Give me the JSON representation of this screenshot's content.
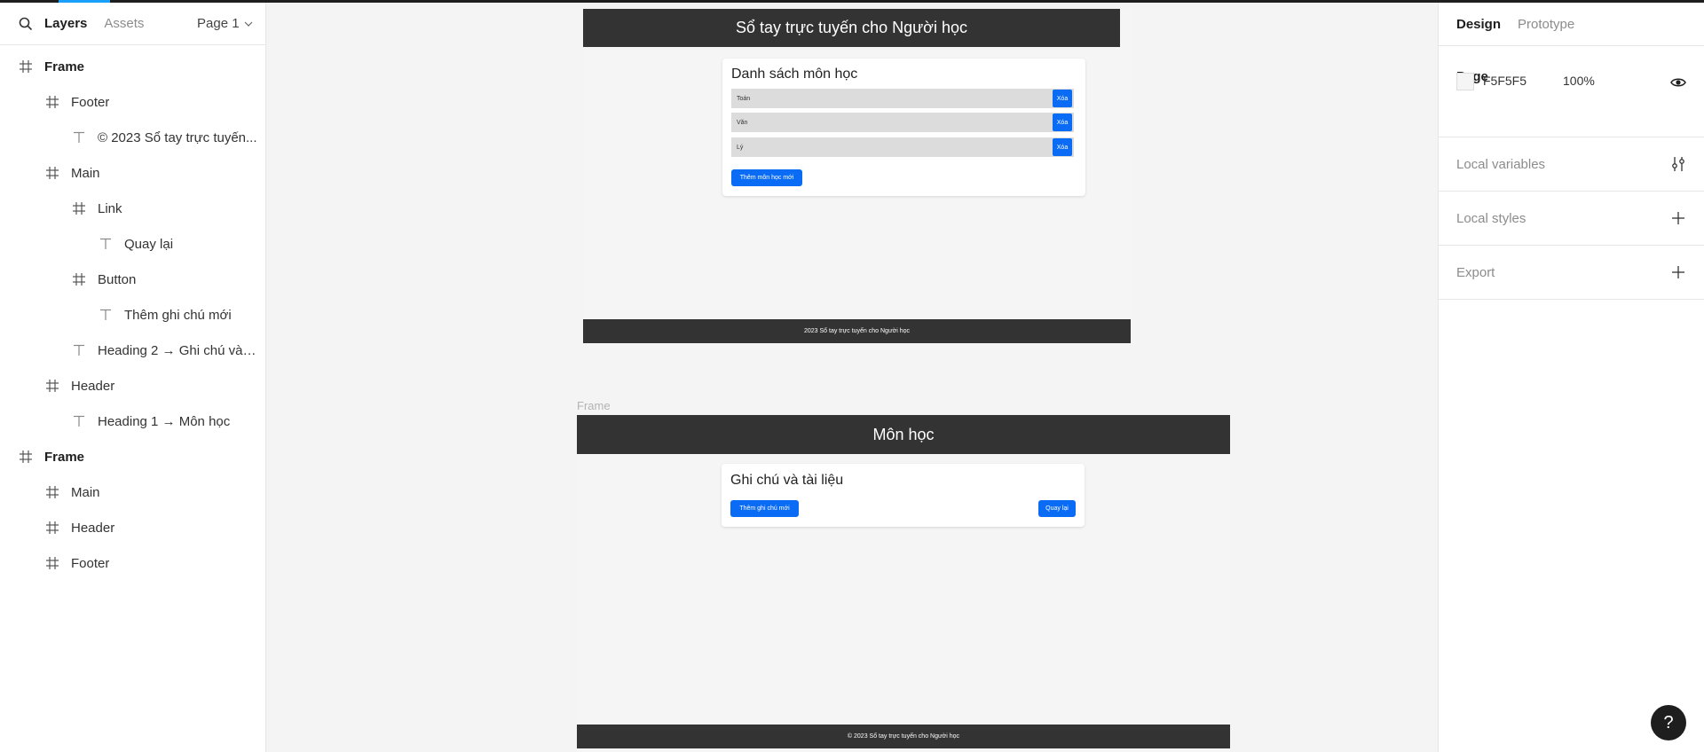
{
  "left_panel": {
    "tabs": {
      "layers": "Layers",
      "assets": "Assets"
    },
    "page_select": "Page 1",
    "layers": [
      {
        "label": "Frame",
        "icon": "frame-icon"
      },
      {
        "label": "Footer",
        "icon": "frame-icon"
      },
      {
        "label": "© 2023 Sổ tay trực tuyến...",
        "icon": "text-icon"
      },
      {
        "label": "Main",
        "icon": "frame-icon"
      },
      {
        "label": "Link",
        "icon": "frame-icon"
      },
      {
        "label": "Quay lại",
        "icon": "text-icon"
      },
      {
        "label": "Button",
        "icon": "frame-icon"
      },
      {
        "label": "Thêm ghi chú mới",
        "icon": "text-icon"
      },
      {
        "label": "Heading 2 → Ghi chú và t...",
        "icon": "text-icon"
      },
      {
        "label": "Header",
        "icon": "frame-icon"
      },
      {
        "label": "Heading 1 → Môn học",
        "icon": "text-icon"
      },
      {
        "label": "Frame",
        "icon": "frame-icon"
      },
      {
        "label": "Main",
        "icon": "frame-icon"
      },
      {
        "label": "Header",
        "icon": "frame-icon"
      },
      {
        "label": "Footer",
        "icon": "frame-icon"
      }
    ]
  },
  "right_panel": {
    "tabs": {
      "design": "Design",
      "prototype": "Prototype"
    },
    "page": {
      "title": "Page",
      "color_hex": "F5F5F5",
      "opacity": "100%"
    },
    "sections": {
      "local_variables": "Local variables",
      "local_styles": "Local styles",
      "export": "Export"
    }
  },
  "canvas": {
    "frame1": {
      "header_title": "Sổ tay trực tuyến cho Người học",
      "card_title": "Danh sách môn học",
      "subjects": [
        {
          "name": "Toán",
          "delete_label": "Xóa"
        },
        {
          "name": "Văn",
          "delete_label": "Xóa"
        },
        {
          "name": "Lý",
          "delete_label": "Xóa"
        }
      ],
      "add_button": "Thêm môn học mới",
      "footer_text": "2023 Sổ tay trực tuyến cho Người học"
    },
    "frame2": {
      "label": "Frame",
      "header_title": "Môn học",
      "card_title": "Ghi chú và tài liệu",
      "add_note_button": "Thêm ghi chú mới",
      "back_button": "Quay lại",
      "footer_text": "© 2023 Sổ tay trực tuyến cho Người học"
    }
  },
  "help_button": "?",
  "colors": {
    "accent": "#18a0fb",
    "primary_button": "#0a6cf5",
    "header_bg": "#333333"
  }
}
